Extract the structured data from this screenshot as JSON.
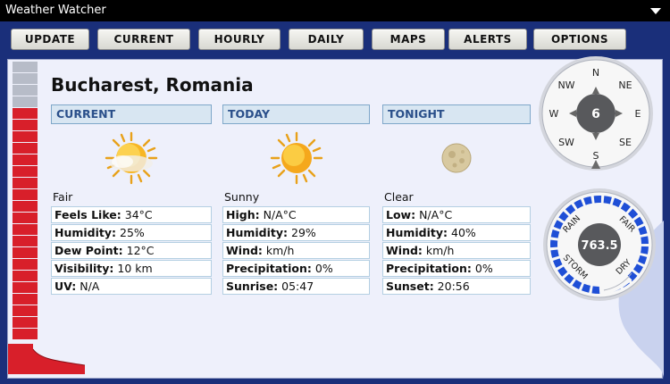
{
  "window": {
    "title": "Weather Watcher"
  },
  "toolbar": {
    "buttons": [
      {
        "id": "update",
        "label": "UPDATE"
      },
      {
        "id": "current",
        "label": "CURRENT"
      },
      {
        "id": "hourly",
        "label": "HOURLY"
      },
      {
        "id": "daily",
        "label": "DAILY"
      },
      {
        "id": "maps",
        "label": "MAPS"
      },
      {
        "id": "alerts",
        "label": "ALERTS"
      },
      {
        "id": "options",
        "label": "OPTIONS"
      }
    ]
  },
  "location": "Bucharest, Romania",
  "thermometer": {
    "level_fraction": 0.55
  },
  "current": {
    "heading": "CURRENT",
    "icon": "sun-with-cloud-icon",
    "condition": "Fair",
    "rows": [
      {
        "label": "Feels Like:",
        "value": " 34°C"
      },
      {
        "label": "Humidity:",
        "value": " 25%"
      },
      {
        "label": "Dew Point:",
        "value": " 12°C"
      },
      {
        "label": "Visibility:",
        "value": " 10 km"
      },
      {
        "label": "UV:",
        "value": " N/A"
      }
    ]
  },
  "today": {
    "heading": "TODAY",
    "icon": "sun-icon",
    "condition": "Sunny",
    "rows": [
      {
        "label": "High:",
        "value": " N/A°C"
      },
      {
        "label": "Humidity:",
        "value": "   29%"
      },
      {
        "label": "Wind:",
        "value": "  km/h"
      },
      {
        "label": "Precipitation:",
        "value": "   0%"
      },
      {
        "label": "Sunrise:",
        "value": " 05:47"
      }
    ]
  },
  "tonight": {
    "heading": "TONIGHT",
    "icon": "moon-icon",
    "condition": "Clear",
    "rows": [
      {
        "label": "Low:",
        "value": " N/A°C"
      },
      {
        "label": "Humidity:",
        "value": "   40%"
      },
      {
        "label": "Wind:",
        "value": "  km/h"
      },
      {
        "label": "Precipitation:",
        "value": "   0%"
      },
      {
        "label": "Sunset:",
        "value": " 20:56"
      }
    ]
  },
  "compass": {
    "value": "6",
    "directions": [
      "N",
      "NE",
      "E",
      "SE",
      "S",
      "SW",
      "W",
      "NW"
    ]
  },
  "barometer": {
    "value": "763.5",
    "labels": [
      "RAIN",
      "FAIR",
      "STORM",
      "DRY"
    ]
  },
  "colors": {
    "thermo_red": "#d81f2a",
    "thermo_grey": "#b7bcc8",
    "heading_text": "#2a4f8a",
    "barometer_blue": "#1f4fd6"
  }
}
